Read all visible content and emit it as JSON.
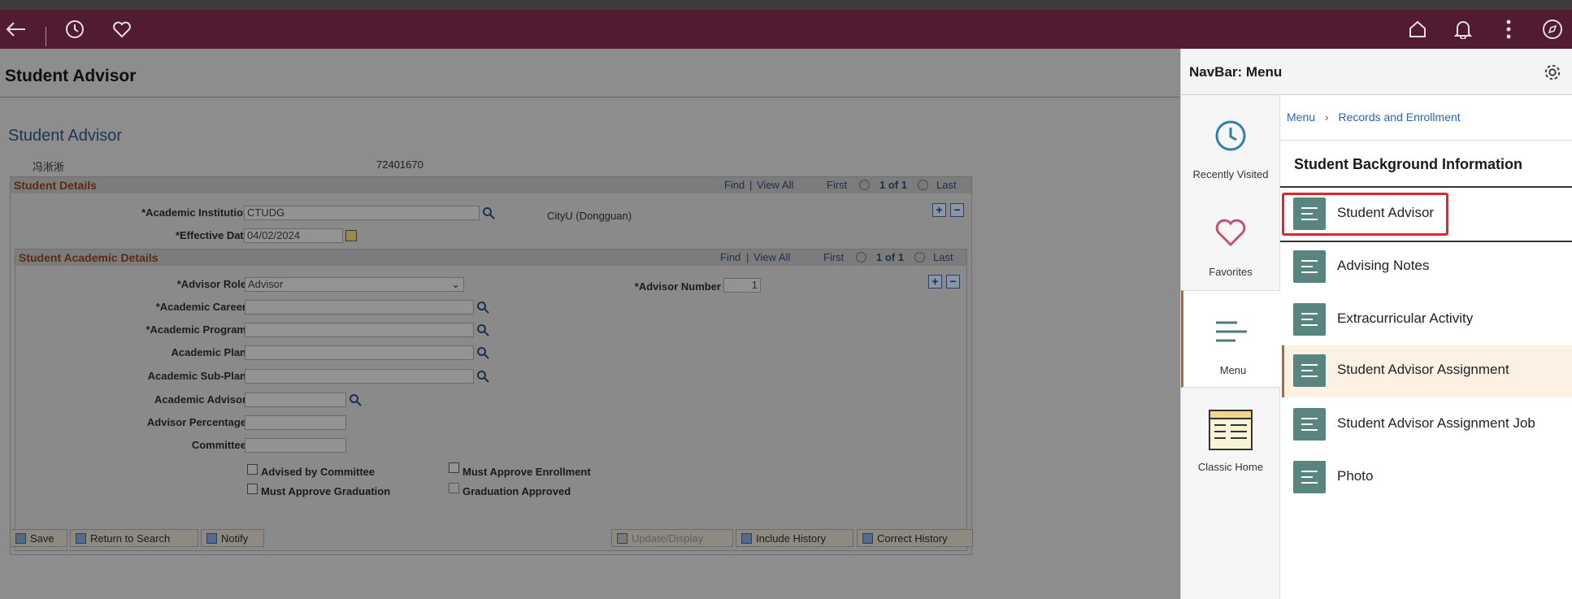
{
  "browser_bar": {
    "back_icon": "back-arrow-icon",
    "history_icon": "clock-icon",
    "favorites_icon": "heart-icon",
    "home_icon": "home-icon",
    "notifications_icon": "bell-icon",
    "actions_icon": "more-vertical-icon",
    "navbar_icon": "compass-icon"
  },
  "page": {
    "title": "Student Advisor",
    "subtitle": "Student Advisor",
    "student_name": "冯淅淅",
    "student_id": "72401670",
    "student_details": {
      "header": "Student Details",
      "find": "Find",
      "view_all": "View All",
      "first": "First",
      "count": "1 of 1",
      "last": "Last",
      "academic_institution_label": "*Academic Institution",
      "academic_institution_value": "CTUDG",
      "institution_description": "CityU (Dongguan)",
      "effective_date_label": "*Effective Date",
      "effective_date_value": "04/02/2024"
    },
    "academic_details": {
      "header": "Student Academic Details",
      "find": "Find",
      "view_all": "View All",
      "first": "First",
      "count": "1 of 1",
      "last": "Last",
      "advisor_role_label": "*Advisor Role",
      "advisor_role_value": "Advisor",
      "advisor_number_label": "*Advisor Number",
      "advisor_number_value": "1",
      "academic_career_label": "*Academic Career",
      "academic_program_label": "*Academic Program",
      "academic_plan_label": "Academic Plan",
      "academic_subplan_label": "Academic Sub-Plan",
      "academic_advisor_label": "Academic Advisor",
      "advisor_percentage_label": "Advisor Percentage",
      "committee_label": "Committee",
      "advised_by_committee": "Advised by Committee",
      "must_approve_enrollment": "Must Approve Enrollment",
      "must_approve_graduation": "Must Approve Graduation",
      "graduation_approved": "Graduation Approved"
    },
    "buttons": {
      "save": "Save",
      "return_to_search": "Return to Search",
      "notify": "Notify",
      "update_display": "Update/Display",
      "include_history": "Include History",
      "correct_history": "Correct History"
    }
  },
  "navbar": {
    "title": "NavBar: Menu",
    "settings_icon": "gear-icon",
    "tiles": [
      {
        "label": "Recently Visited",
        "icon": "clock-icon"
      },
      {
        "label": "Favorites",
        "icon": "heart-icon"
      },
      {
        "label": "Menu",
        "icon": "menu-lines-icon"
      },
      {
        "label": "Classic Home",
        "icon": "classic-home-icon"
      }
    ],
    "breadcrumb": {
      "root": "Menu",
      "current": "Records and Enrollment"
    },
    "section_title": "Student Background Information",
    "items": [
      {
        "label": "Student Advisor"
      },
      {
        "label": "Advising Notes"
      },
      {
        "label": "Extracurricular Activity"
      },
      {
        "label": "Student Advisor Assignment"
      },
      {
        "label": "Student Advisor Assignment Job"
      },
      {
        "label": "Photo"
      }
    ],
    "colors": {
      "accent": "#58857f",
      "highlight_border": "#e0252b",
      "link": "#2864b4",
      "banner": "#511c32"
    }
  }
}
